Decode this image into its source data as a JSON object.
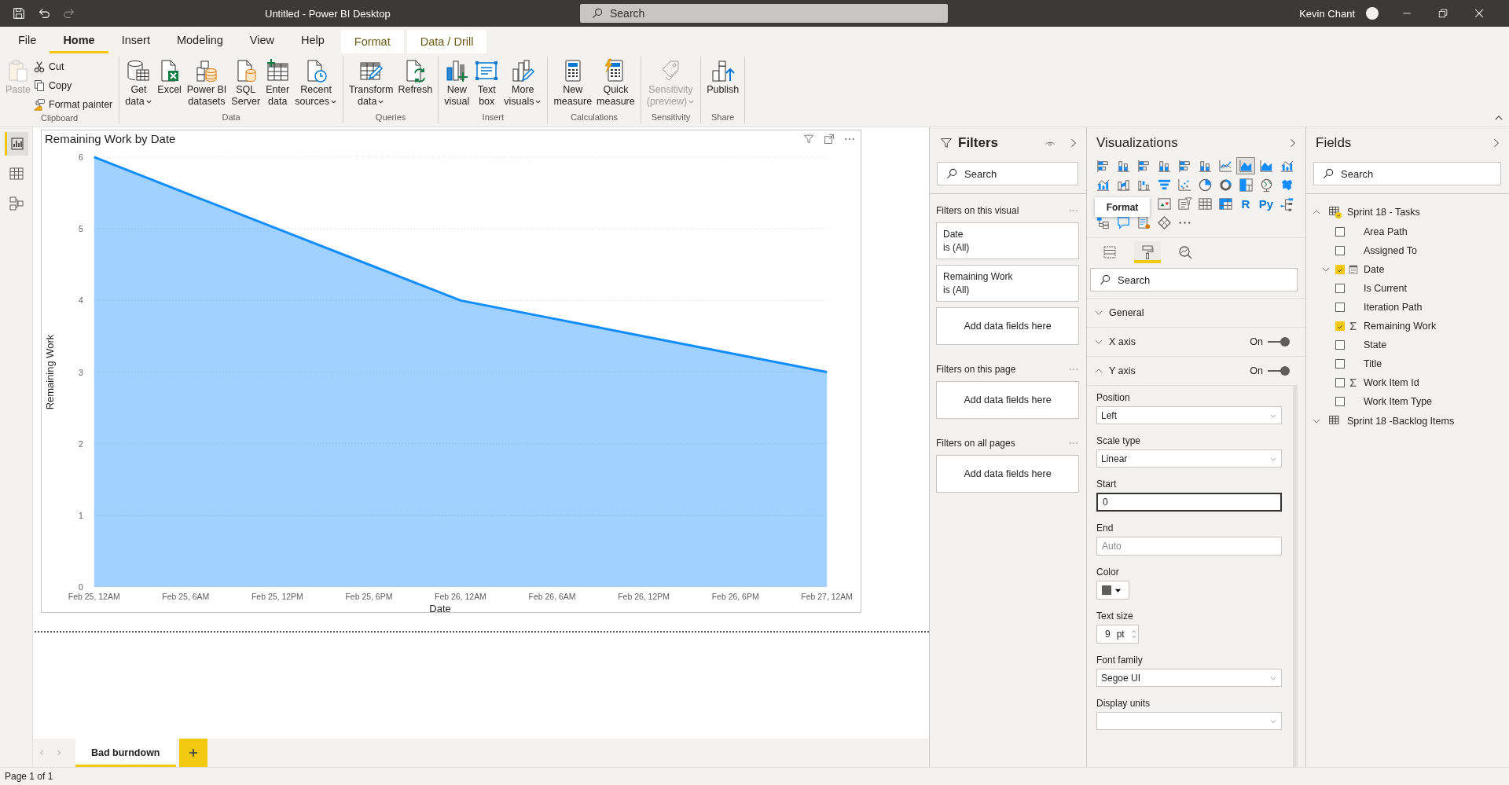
{
  "title_bar": {
    "title": "Untitled - Power BI Desktop",
    "search_placeholder": "Search",
    "user": "Kevin Chant"
  },
  "ribbon": {
    "tabs": [
      {
        "label": "File",
        "selected": false,
        "kind": "standard"
      },
      {
        "label": "Home",
        "selected": true,
        "kind": "standard"
      },
      {
        "label": "Insert",
        "selected": false,
        "kind": "standard"
      },
      {
        "label": "Modeling",
        "selected": false,
        "kind": "standard"
      },
      {
        "label": "View",
        "selected": false,
        "kind": "standard"
      },
      {
        "label": "Help",
        "selected": false,
        "kind": "standard"
      },
      {
        "label": "Format",
        "selected": false,
        "kind": "contextual"
      },
      {
        "label": "Data / Drill",
        "selected": false,
        "kind": "contextual"
      }
    ],
    "groups": [
      {
        "label": "Clipboard",
        "large": [
          {
            "kind": "paste",
            "lines": [
              "Paste"
            ],
            "dropdown": false,
            "disabled": true
          }
        ],
        "small": [
          {
            "kind": "cut",
            "label": "Cut"
          },
          {
            "kind": "copy",
            "label": "Copy"
          },
          {
            "kind": "painter",
            "label": "Format painter"
          }
        ]
      },
      {
        "label": "Data",
        "large": [
          {
            "kind": "get-data",
            "lines": [
              "Get",
              "data"
            ],
            "dropdown": true,
            "disabled": false
          },
          {
            "kind": "excel",
            "lines": [
              "Excel"
            ],
            "dropdown": false,
            "disabled": false
          },
          {
            "kind": "datasets",
            "lines": [
              "Power BI",
              "datasets"
            ],
            "dropdown": false,
            "disabled": false
          },
          {
            "kind": "sql",
            "lines": [
              "SQL",
              "Server"
            ],
            "dropdown": false,
            "disabled": false
          },
          {
            "kind": "enter-data",
            "lines": [
              "Enter",
              "data"
            ],
            "dropdown": false,
            "disabled": false
          },
          {
            "kind": "recent",
            "lines": [
              "Recent",
              "sources"
            ],
            "dropdown": true,
            "disabled": false
          }
        ]
      },
      {
        "label": "Queries",
        "large": [
          {
            "kind": "transform",
            "lines": [
              "Transform",
              "data"
            ],
            "dropdown": true,
            "disabled": false
          },
          {
            "kind": "refresh",
            "lines": [
              "Refresh"
            ],
            "dropdown": false,
            "disabled": false
          }
        ]
      },
      {
        "label": "Insert",
        "large": [
          {
            "kind": "new-visual",
            "lines": [
              "New",
              "visual"
            ],
            "dropdown": false,
            "disabled": false
          },
          {
            "kind": "text-box",
            "lines": [
              "Text",
              "box"
            ],
            "dropdown": false,
            "disabled": false
          },
          {
            "kind": "more-visuals",
            "lines": [
              "More",
              "visuals"
            ],
            "dropdown": true,
            "disabled": false
          }
        ]
      },
      {
        "label": "Calculations",
        "large": [
          {
            "kind": "new-measure",
            "lines": [
              "New",
              "measure"
            ],
            "dropdown": false,
            "disabled": false
          },
          {
            "kind": "quick-measure",
            "lines": [
              "Quick",
              "measure"
            ],
            "dropdown": false,
            "disabled": false
          }
        ]
      },
      {
        "label": "Sensitivity",
        "large": [
          {
            "kind": "sensitivity",
            "lines": [
              "Sensitivity",
              "(preview)"
            ],
            "dropdown": true,
            "disabled": true
          }
        ]
      },
      {
        "label": "Share",
        "large": [
          {
            "kind": "publish",
            "lines": [
              "Publish"
            ],
            "dropdown": false,
            "disabled": false
          }
        ]
      }
    ]
  },
  "left_nav": [
    {
      "kind": "report",
      "selected": true
    },
    {
      "kind": "data",
      "selected": false
    },
    {
      "kind": "model",
      "selected": false
    }
  ],
  "canvas": {
    "visual": {
      "chart_data": {
        "type": "area",
        "title": "Remaining Work by Date",
        "xlabel": "Date",
        "ylabel": "Remaining Work",
        "categories": [
          "Feb 25, 12AM",
          "Feb 25, 6AM",
          "Feb 25, 12PM",
          "Feb 25, 6PM",
          "Feb 26, 12AM",
          "Feb 26, 6AM",
          "Feb 26, 12PM",
          "Feb 26, 6PM",
          "Feb 27, 12AM"
        ],
        "series": [
          {
            "color": "#118dff",
            "values": [
              6,
              5.5,
              5,
              4.5,
              4,
              3.75,
              3.5,
              3.25,
              3
            ]
          }
        ],
        "ylim": [
          0,
          6
        ],
        "grid": true,
        "yticks": [
          0,
          1,
          2,
          3,
          4,
          5,
          6
        ]
      }
    }
  },
  "page_tabs": [
    {
      "label": "Bad burndown",
      "selected": true
    }
  ],
  "filters": {
    "title": "Filters",
    "search_placeholder": "Search",
    "sections": [
      {
        "title": "Filters on this visual",
        "cards": [
          {
            "field": "Date",
            "condition": "is (All)"
          },
          {
            "field": "Remaining Work",
            "condition": "is (All)"
          }
        ],
        "drop_hint": "Add data fields here"
      },
      {
        "title": "Filters on this page",
        "drop_hint": "Add data fields here"
      },
      {
        "title": "Filters on all pages",
        "drop_hint": "Add data fields here"
      }
    ]
  },
  "visualizations": {
    "title": "Visualizations",
    "visual_types": [
      {
        "kind": "bar",
        "selected": false
      },
      {
        "kind": "column",
        "selected": false
      },
      {
        "kind": "bar",
        "selected": false
      },
      {
        "kind": "column",
        "selected": false
      },
      {
        "kind": "bar",
        "selected": false
      },
      {
        "kind": "column",
        "selected": false
      },
      {
        "kind": "line",
        "selected": false
      },
      {
        "kind": "area",
        "selected": true
      },
      {
        "kind": "area",
        "selected": false
      },
      {
        "kind": "combo",
        "selected": false
      },
      {
        "kind": "combo",
        "selected": false
      },
      {
        "kind": "ribbon",
        "selected": false
      },
      {
        "kind": "waterfall",
        "selected": false
      },
      {
        "kind": "funnel",
        "selected": false
      },
      {
        "kind": "scatter",
        "selected": false
      },
      {
        "kind": "pie",
        "selected": false
      },
      {
        "kind": "donut",
        "selected": false
      },
      {
        "kind": "treemap",
        "selected": false
      },
      {
        "kind": "globe",
        "selected": false
      },
      {
        "kind": "map",
        "selected": false
      },
      {
        "kind": "kpi",
        "selected": false
      },
      {
        "kind": "slicer",
        "selected": false
      },
      {
        "kind": "table",
        "selected": false
      },
      {
        "kind": "matrix",
        "selected": false
      },
      {
        "kind": "script",
        "label": "R",
        "selected": false
      },
      {
        "kind": "script",
        "label": "Py",
        "selected": false
      },
      {
        "kind": "decomposition",
        "selected": false
      },
      {
        "kind": "hierarchy",
        "selected": false
      },
      {
        "kind": "qa",
        "selected": false
      },
      {
        "kind": "narrative",
        "selected": false
      },
      {
        "kind": "diamond",
        "selected": false
      },
      {
        "kind": "more",
        "selected": false
      }
    ],
    "tooltip": "Format",
    "pane_tabs": [
      {
        "kind": "fields",
        "selected": false
      },
      {
        "kind": "format",
        "selected": true
      },
      {
        "kind": "analytics",
        "selected": false
      }
    ],
    "search_placeholder": "Search",
    "sections": [
      {
        "label": "General",
        "expanded": false
      },
      {
        "label": "X axis",
        "expanded": false,
        "switch_label": "On",
        "on": true
      },
      {
        "label": "Y axis",
        "expanded": true,
        "switch_label": "On",
        "on": true
      }
    ],
    "properties": [
      {
        "kind": "dropdown",
        "label": "Position",
        "value": "Left"
      },
      {
        "kind": "dropdown",
        "label": "Scale type",
        "value": "Linear"
      },
      {
        "kind": "input",
        "label": "Start",
        "value": "0",
        "focused": true
      },
      {
        "kind": "input",
        "label": "End",
        "placeholder": "Auto",
        "focused": false
      },
      {
        "kind": "color",
        "label": "Color"
      },
      {
        "kind": "spin",
        "label": "Text size",
        "value": "9",
        "unit": "pt"
      },
      {
        "kind": "dropdown",
        "label": "Font family",
        "value": "Segoe UI"
      },
      {
        "kind": "dropdown",
        "label": "Display units"
      }
    ]
  },
  "fields": {
    "title": "Fields",
    "search_placeholder": "Search",
    "tables": [
      {
        "name": "Sprint 18 - Tasks",
        "expanded": true,
        "in_use": true,
        "children": [
          {
            "name": "Area Path",
            "kind": "text",
            "checked": false
          },
          {
            "name": "Assigned To",
            "kind": "text",
            "checked": false
          },
          {
            "name": "Date",
            "kind": "date",
            "checked": true
          },
          {
            "name": "Is Current",
            "kind": "text",
            "checked": false
          },
          {
            "name": "Iteration Path",
            "kind": "text",
            "checked": false
          },
          {
            "name": "Remaining Work",
            "kind": "sum",
            "checked": true
          },
          {
            "name": "State",
            "kind": "text",
            "checked": false
          },
          {
            "name": "Title",
            "kind": "text",
            "checked": false
          },
          {
            "name": "Work Item Id",
            "kind": "sum",
            "checked": false
          },
          {
            "name": "Work Item Type",
            "kind": "text",
            "checked": false
          }
        ]
      },
      {
        "name": "Sprint 18 -Backlog Items",
        "expanded": false,
        "in_use": false
      }
    ]
  },
  "status_bar": "Page 1 of 1"
}
